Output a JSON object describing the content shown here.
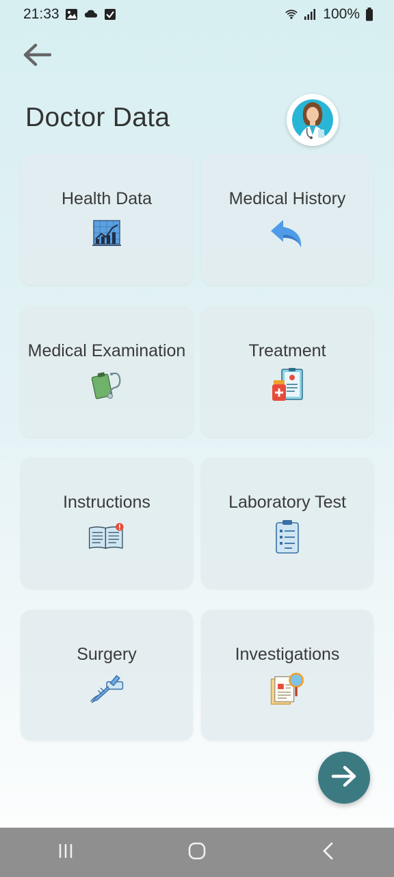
{
  "status_bar": {
    "time": "21:33",
    "battery": "100%",
    "left_icons": [
      "image-icon",
      "cloud-icon",
      "checkbox-icon"
    ],
    "right_icons": [
      "wifi-icon",
      "signal-icon",
      "battery-icon"
    ]
  },
  "header": {
    "back_icon": "arrow-left-icon",
    "title": "Doctor Data",
    "avatar": "doctor-avatar"
  },
  "cards": [
    {
      "label": "Health Data",
      "icon": "chart-icon"
    },
    {
      "label": "Medical History",
      "icon": "history-arrow-icon"
    },
    {
      "label": "Medical Examination",
      "icon": "stethoscope-icon"
    },
    {
      "label": "Treatment",
      "icon": "medicine-icon"
    },
    {
      "label": "Instructions",
      "icon": "book-icon"
    },
    {
      "label": "Laboratory Test",
      "icon": "clipboard-icon"
    },
    {
      "label": "Surgery",
      "icon": "scalpel-icon"
    },
    {
      "label": "Investigations",
      "icon": "magnifier-document-icon"
    }
  ],
  "fab": {
    "icon": "arrow-right-icon"
  },
  "nav": {
    "icons": [
      "recents-icon",
      "home-icon",
      "back-icon"
    ]
  },
  "colors": {
    "accent": "#3c7a82",
    "card_bg": "#e2ecee",
    "text": "#333333",
    "nav_bar": "#8f8f8f"
  }
}
